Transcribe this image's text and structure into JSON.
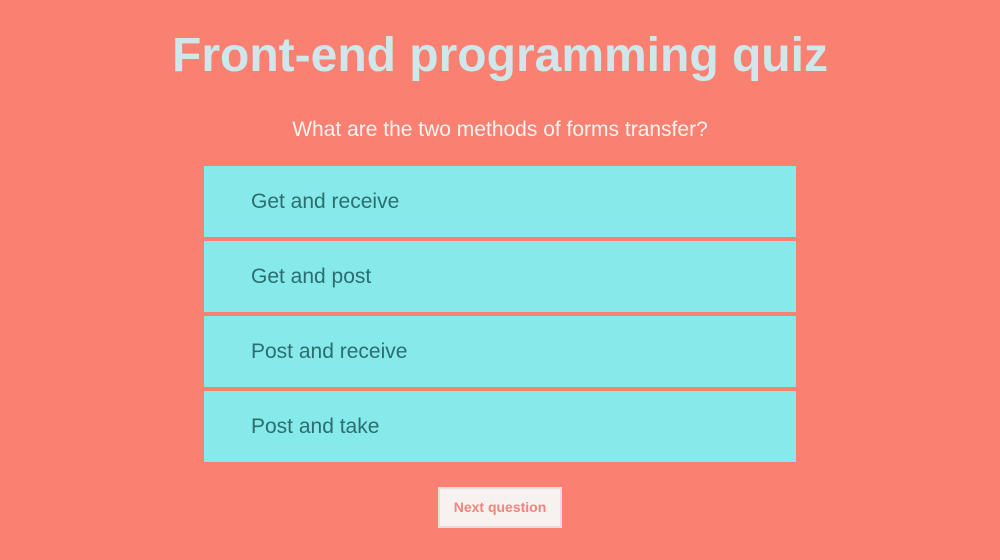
{
  "quiz": {
    "title": "Front-end programming quiz",
    "question": "What are the two methods of forms transfer?",
    "answers": [
      {
        "label": "Get and receive"
      },
      {
        "label": "Get and post"
      },
      {
        "label": "Post and receive"
      },
      {
        "label": "Post and take"
      }
    ],
    "next_label": "Next question"
  },
  "colors": {
    "background": "#fa8072",
    "answer_background": "#86eaea",
    "answer_text": "#2c6e70",
    "title_text": "#cfe7ea",
    "button_background": "#f7f1f0",
    "button_text": "#f0857a"
  }
}
